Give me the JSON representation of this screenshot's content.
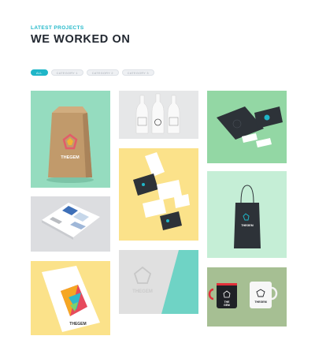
{
  "header": {
    "eyebrow": "LATEST PROJECTS",
    "title": "WE WORKED ON"
  },
  "filters": [
    "ALL",
    "CATEGORY 1",
    "CATEGORY 2",
    "CATEGORY 3"
  ],
  "brand": {
    "logo_text": "THEGEM",
    "logo_text_split_1": "THE",
    "logo_text_split_2": "GEM"
  },
  "colors": {
    "accent": "#1fb6c8",
    "heading": "#222831",
    "mint": "#95dcbf",
    "yellow": "#fbe28a",
    "green": "#93d7a4",
    "grey": "#e5e6e8",
    "olive": "#a6bf93"
  },
  "portfolio": [
    {
      "name": "kraft-paper-bag",
      "bg": "#95dcbf"
    },
    {
      "name": "printed-bottles",
      "bg": "#e6e7e8"
    },
    {
      "name": "stationery-set",
      "bg": "#93d7a4"
    },
    {
      "name": "floating-business-cards",
      "bg": "#fbe28a"
    },
    {
      "name": "shopping-bag",
      "bg": "#c5eed6"
    },
    {
      "name": "magazine-spread",
      "bg": "#dcdde0"
    },
    {
      "name": "folded-brochure",
      "bg": "#fbe28a"
    },
    {
      "name": "embossed-logo",
      "bg": "#e2e2e2"
    },
    {
      "name": "coffee-mugs",
      "bg": "#a6bf93"
    }
  ]
}
